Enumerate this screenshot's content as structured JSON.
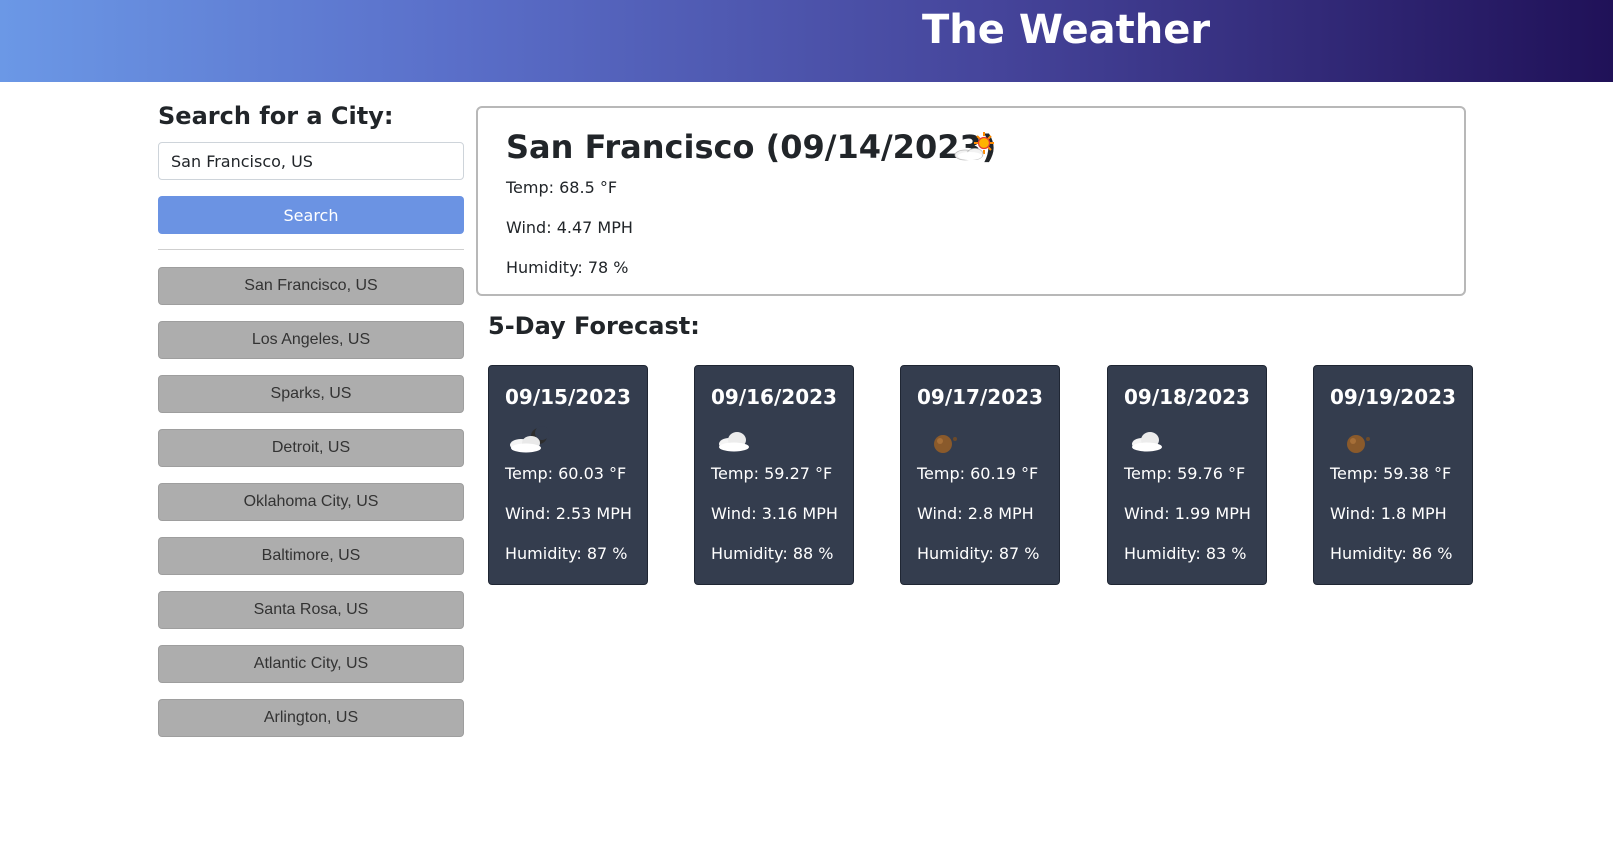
{
  "header": {
    "title": "The Weather"
  },
  "search": {
    "title": "Search for a City:",
    "input_value": "San Francisco, US",
    "button_label": "Search"
  },
  "history": [
    "San Francisco, US",
    "Los Angeles, US",
    "Sparks, US",
    "Detroit, US",
    "Oklahoma City, US",
    "Baltimore, US",
    "Santa Rosa, US",
    "Atlantic City, US",
    "Arlington, US"
  ],
  "current": {
    "heading": "San Francisco (09/14/2023)",
    "icon": "partly-cloudy-sun-icon",
    "temp": "Temp: 68.5 °F",
    "wind": "Wind: 4.47 MPH",
    "humidity": "Humidity: 78 %"
  },
  "forecast": {
    "title": "5-Day Forecast:",
    "days": [
      {
        "date": "09/15/2023",
        "icon": "cloudy-night-icon",
        "temp": "Temp: 60.03 °F",
        "wind": "Wind: 2.53 MPH",
        "humidity": "Humidity: 87 %"
      },
      {
        "date": "09/16/2023",
        "icon": "cloud-icon",
        "temp": "Temp: 59.27 °F",
        "wind": "Wind: 3.16 MPH",
        "humidity": "Humidity: 88 %"
      },
      {
        "date": "09/17/2023",
        "icon": "clear-night-icon",
        "temp": "Temp: 60.19 °F",
        "wind": "Wind: 2.8 MPH",
        "humidity": "Humidity: 87 %"
      },
      {
        "date": "09/18/2023",
        "icon": "cloud-icon",
        "temp": "Temp: 59.76 °F",
        "wind": "Wind: 1.99 MPH",
        "humidity": "Humidity: 83 %"
      },
      {
        "date": "09/19/2023",
        "icon": "clear-night-icon",
        "temp": "Temp: 59.38 °F",
        "wind": "Wind: 1.8 MPH",
        "humidity": "Humidity: 86 %"
      }
    ]
  },
  "colors": {
    "header_gradient": [
      "#6b98e6",
      "#201158"
    ],
    "search_button": "#6b93e3",
    "history_button": "#adadad",
    "forecast_card": "#343d4e"
  }
}
